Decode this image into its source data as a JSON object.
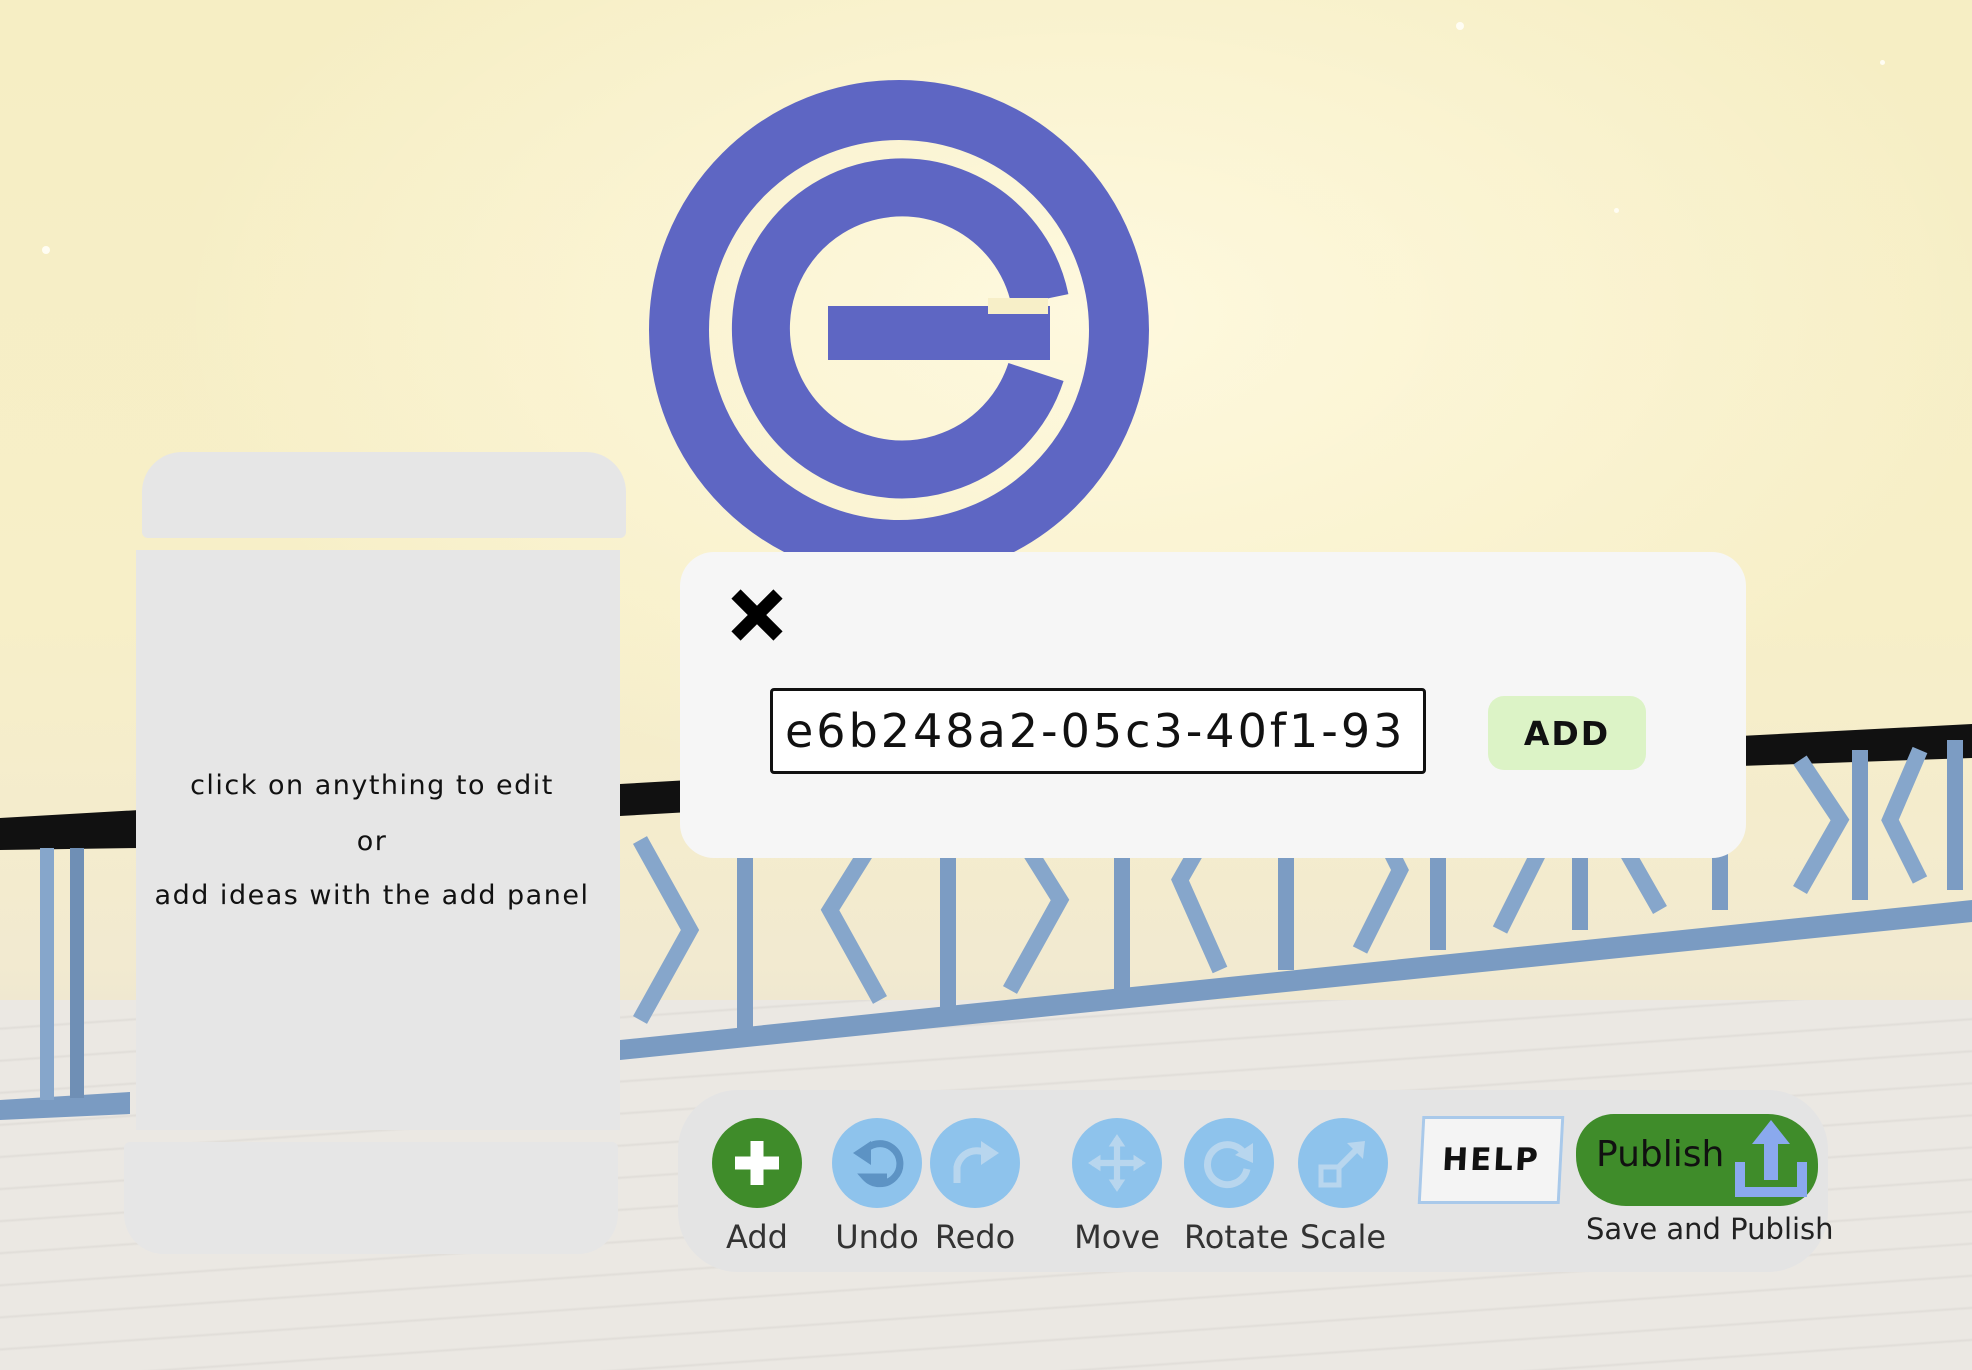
{
  "hint_panel": {
    "line1": "click on anything to edit",
    "line2": "or",
    "line3": "add ideas with the add panel"
  },
  "add_dialog": {
    "close_icon": "close-x-icon",
    "input_value": "e6b248a2-05c3-40f1-93",
    "add_button_label": "ADD"
  },
  "toolbar": {
    "add_label": "Add",
    "undo_label": "Undo",
    "redo_label": "Redo",
    "move_label": "Move",
    "rotate_label": "Rotate",
    "scale_label": "Scale",
    "help_label": "HELP",
    "publish_label": "Publish",
    "publish_caption": "Save and Publish"
  },
  "colors": {
    "logo": "#5e66c3",
    "add_button": "#3f8c2a",
    "tool_button": "#8ec3ec",
    "add_id_button": "#dcf3c6",
    "panel": "#e6e6e6",
    "fence": "#7f9fc4"
  }
}
